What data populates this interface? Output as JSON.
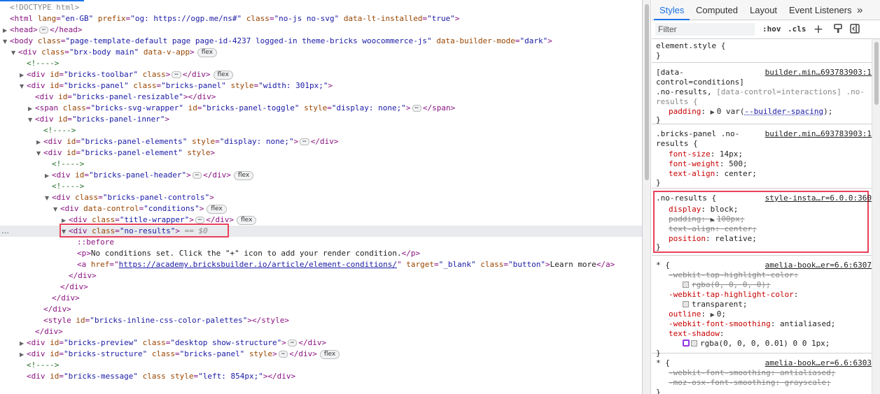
{
  "elements": {
    "doctype": "<!DOCTYPE html>",
    "line_html": {
      "tag": "<html",
      "attrs": [
        [
          "lang",
          "\"en-GB\""
        ],
        [
          "prefix",
          "\"og: https://ogp.me/ns#\""
        ],
        [
          "class",
          "\"no-js no-svg\""
        ],
        [
          "data-lt-installed",
          "\"true\""
        ]
      ],
      "close": ">"
    },
    "head": {
      "open": "<head>",
      "close": "</head>"
    },
    "body": {
      "tag": "<body",
      "attrs": [
        [
          "class",
          "\"page-template-default page page-id-4237 logged-in theme-bricks woocommerce-js\""
        ],
        [
          "data-builder-mode",
          "\"dark\""
        ]
      ],
      "close": ">"
    },
    "brx_body": {
      "tag": "<div",
      "attrs": [
        [
          "class",
          "\"brx-body main\""
        ],
        [
          "data-v-app",
          ""
        ]
      ],
      "close": ">",
      "badge": "flex"
    },
    "comment": "<!---->",
    "toolbar": {
      "tag": "<div",
      "attrs": [
        [
          "id",
          "\"bricks-toolbar\""
        ],
        [
          "class",
          ""
        ]
      ],
      "close": ">",
      "end": "</div>",
      "badge": "flex"
    },
    "panel": {
      "tag": "<div",
      "attrs": [
        [
          "id",
          "\"bricks-panel\""
        ],
        [
          "class",
          "\"bricks-panel\""
        ],
        [
          "style",
          "\"width: 301px;\""
        ]
      ],
      "close": ">"
    },
    "resizable": {
      "tag": "<div",
      "attrs": [
        [
          "id",
          "\"bricks-panel-resizable\""
        ]
      ],
      "close": ">",
      "end": "</div>"
    },
    "svg_wrapper": {
      "tag": "<span",
      "attrs": [
        [
          "class",
          "\"bricks-svg-wrapper\""
        ],
        [
          "id",
          "\"bricks-panel-toggle\""
        ],
        [
          "style",
          "\"display: none;\""
        ]
      ],
      "close": ">",
      "end": "</span>"
    },
    "panel_inner": {
      "tag": "<div",
      "attrs": [
        [
          "id",
          "\"bricks-panel-inner\""
        ]
      ],
      "close": ">"
    },
    "panel_elements": {
      "tag": "<div",
      "attrs": [
        [
          "id",
          "\"bricks-panel-elements\""
        ],
        [
          "style",
          "\"display: none;\""
        ]
      ],
      "close": ">",
      "end": "</div>"
    },
    "panel_element": {
      "tag": "<div",
      "attrs": [
        [
          "id",
          "\"bricks-panel-element\""
        ],
        [
          "style",
          ""
        ]
      ],
      "close": ">"
    },
    "panel_header": {
      "tag": "<div",
      "attrs": [
        [
          "id",
          "\"bricks-panel-header\""
        ]
      ],
      "close": ">",
      "end": "</div>",
      "badge": "flex"
    },
    "panel_controls": {
      "tag": "<div",
      "attrs": [
        [
          "class",
          "\"bricks-panel-controls\""
        ]
      ],
      "close": ">"
    },
    "conditions": {
      "tag": "<div",
      "attrs": [
        [
          "data-control",
          "\"conditions\""
        ]
      ],
      "close": ">",
      "badge": "flex"
    },
    "title_wrapper": {
      "tag": "<div",
      "attrs": [
        [
          "class",
          "\"title-wrapper\""
        ]
      ],
      "close": ">",
      "end": "</div>",
      "badge": "flex"
    },
    "no_results": {
      "tag": "<div",
      "attrs": [
        [
          "class",
          "\"no-results\""
        ]
      ],
      "close": ">",
      "eq": "== $0"
    },
    "before": "::before",
    "p": {
      "open": "<p>",
      "text": "No conditions set. Click the \"+\" icon to add your render condition.",
      "close": "</p>"
    },
    "a": {
      "tag": "<a",
      "href_name": "href",
      "href": "https://academy.bricksbuilder.io/article/element-conditions/",
      "attrs": [
        [
          "target",
          "\"_blank\""
        ],
        [
          "class",
          "\"button\""
        ]
      ],
      "close": ">",
      "text": "Learn more",
      "end": "</a>"
    },
    "div_close": "</div>",
    "style_tag": {
      "tag": "<style",
      "attrs": [
        [
          "id",
          "\"bricks-inline-css-color-palettes\""
        ]
      ],
      "close": ">",
      "end": "</style>"
    },
    "preview": {
      "tag": "<div",
      "attrs": [
        [
          "id",
          "\"bricks-preview\""
        ],
        [
          "class",
          "\"desktop show-structure\""
        ]
      ],
      "close": ">",
      "end": "</div>"
    },
    "structure": {
      "tag": "<div",
      "attrs": [
        [
          "id",
          "\"bricks-structure\""
        ],
        [
          "class",
          "\"bricks-panel\""
        ],
        [
          "style",
          ""
        ]
      ],
      "close": ">",
      "end": "</div>",
      "badge": "flex"
    },
    "message": {
      "tag": "<div",
      "attrs": [
        [
          "id",
          "\"bricks-message\""
        ],
        [
          "class",
          ""
        ],
        [
          "style",
          "\"left: 854px;\""
        ]
      ],
      "close": ">",
      "end": "</div>"
    },
    "row_dots": "…"
  },
  "styles": {
    "tabs": [
      "Styles",
      "Computed",
      "Layout",
      "Event Listeners"
    ],
    "more": "»",
    "filter_placeholder": "Filter",
    "hov": ":hov",
    "cls": ".cls",
    "rules": [
      {
        "lines": [
          "element.style {",
          "}"
        ]
      },
      {
        "source": "builder.min…693783903:1",
        "selector": [
          "[data-",
          "control=conditions]",
          ".no-results,"
        ],
        "selector_dim": "[data-control=interactions] .no-",
        "selector_end": "results {",
        "decls": [
          {
            "prop": "padding",
            "val": "0 var(--builder-spacing);"
          }
        ]
      },
      {
        "source": "builder.min…693783903:1",
        "selector_a": ".bricks-panel .no-",
        "selector_b": "results {",
        "decls": [
          {
            "prop": "font-size",
            "val": "14px;"
          },
          {
            "prop": "font-weight",
            "val": "500;"
          },
          {
            "prop": "text-align",
            "val": "center;"
          }
        ]
      },
      {
        "source": "style-insta…r=6.0.0:360",
        "selector": ".no-results {",
        "decls": [
          {
            "prop": "display",
            "val": "block;"
          },
          {
            "prop": "padding",
            "val": "100px;",
            "struck": true
          },
          {
            "prop": "text-align",
            "val": "center;",
            "struck": true
          },
          {
            "prop": "position",
            "val": "relative;"
          }
        ]
      },
      {
        "source": "amelia-book…er=6.6:6307",
        "selector": "* {",
        "decls": [
          {
            "prop": "-webkit-tap-highlight-color",
            "val": "rgba(0, 0, 0, 0);",
            "struck": true
          },
          {
            "prop": "-webkit-tap-highlight-color",
            "val": "transparent;"
          },
          {
            "prop": "outline",
            "val": "0;"
          },
          {
            "prop": "-webkit-font-smoothing",
            "val": "antialiased;"
          },
          {
            "prop": "text-shadow",
            "val": "rgba(0, 0, 0, 0.01) 0 0 1px;"
          }
        ]
      },
      {
        "source": "amelia-book…er=6.6:6303",
        "selector": "* {",
        "decls": [
          {
            "prop": "-webkit-font-smoothing",
            "val": "antialiased;",
            "struck": true
          },
          {
            "prop": "-moz-osx-font-smoothing",
            "val": "grayscale;",
            "struck": true
          }
        ]
      }
    ]
  },
  "colors": {
    "tag": "#881280",
    "attr_name": "#994500",
    "attr_value": "#1a1aa6",
    "comment": "#236e25",
    "highlight": "#e8415a",
    "active_tab": "#1a73e8"
  }
}
